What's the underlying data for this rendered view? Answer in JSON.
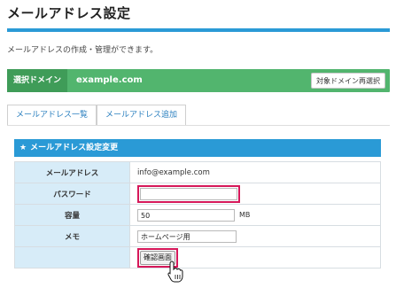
{
  "header": {
    "title": "メールアドレス設定",
    "intro": "メールアドレスの作成・管理ができます。"
  },
  "domain": {
    "label": "選択ドメイン",
    "value": "example.com",
    "reselect_button": "対象ドメイン再選択"
  },
  "tabs": [
    {
      "label": "メールアドレス一覧"
    },
    {
      "label": "メールアドレス追加"
    }
  ],
  "section": {
    "title": "メールアドレス設定変更",
    "icon": "star-icon"
  },
  "form": {
    "email": {
      "label": "メールアドレス",
      "value": "info@example.com"
    },
    "password": {
      "label": "パスワード",
      "value": ""
    },
    "capacity": {
      "label": "容量",
      "value": "50",
      "unit": "MB"
    },
    "memo": {
      "label": "メモ",
      "value": "ホームページ用"
    },
    "confirm_button": "確認画面"
  },
  "colors": {
    "accent_blue": "#2a9ad6",
    "domain_green": "#52b56e",
    "domain_label_green": "#3f9c58",
    "highlight": "#d6185a",
    "label_cell_bg": "#d7ecf8"
  }
}
